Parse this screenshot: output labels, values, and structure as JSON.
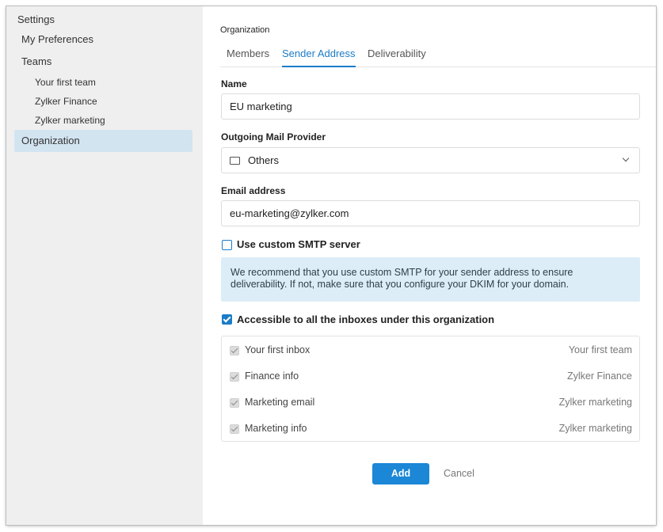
{
  "sidebar": {
    "title": "Settings",
    "items": [
      {
        "label": "My Preferences"
      },
      {
        "label": "Teams"
      },
      {
        "label": "Your first team"
      },
      {
        "label": "Zylker Finance"
      },
      {
        "label": "Zylker marketing"
      },
      {
        "label": "Organization",
        "active": true
      }
    ]
  },
  "main": {
    "section_label": "Organization",
    "tabs": [
      {
        "label": "Members"
      },
      {
        "label": "Sender Address",
        "active": true
      },
      {
        "label": "Deliverability"
      }
    ],
    "form": {
      "name_label": "Name",
      "name_value": "EU marketing",
      "provider_label": "Outgoing Mail Provider",
      "provider_value": "Others",
      "email_label": "Email address",
      "email_value": "eu-marketing@zylker.com",
      "custom_smtp_label": "Use custom SMTP server",
      "custom_smtp_checked": false,
      "info_text": "We recommend that you use custom SMTP for your sender address to ensure deliverability. If not, make sure that you configure your DKIM for your domain.",
      "accessible_label": "Accessible to all the inboxes under this organization",
      "accessible_checked": true,
      "inboxes": [
        {
          "name": "Your first inbox",
          "team": "Your first team"
        },
        {
          "name": "Finance info",
          "team": "Zylker Finance"
        },
        {
          "name": "Marketing email",
          "team": "Zylker marketing"
        },
        {
          "name": "Marketing info",
          "team": "Zylker marketing"
        }
      ]
    },
    "actions": {
      "add_label": "Add",
      "cancel_label": "Cancel"
    }
  },
  "colors": {
    "accent": "#1b87d6",
    "sidebar_bg": "#efefef",
    "sidebar_active_bg": "#d3e4f1",
    "info_bg": "#dcedf8"
  },
  "icons": [
    "mail-icon",
    "chevron-down-icon",
    "checkbox-icon"
  ]
}
